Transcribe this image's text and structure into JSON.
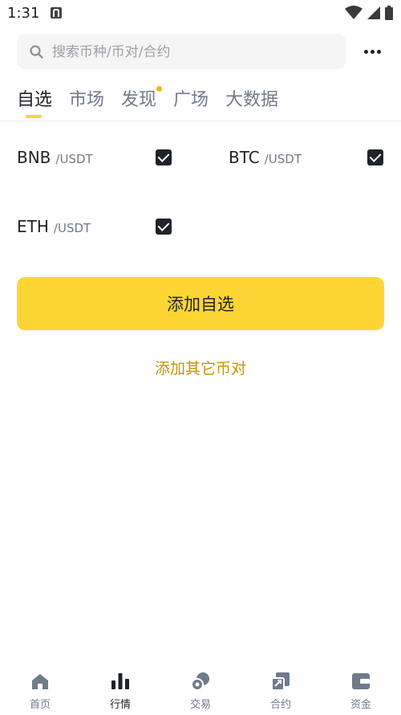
{
  "status_bar": {
    "time": "1:31"
  },
  "search": {
    "placeholder": "搜索币种/币对/合约"
  },
  "tabs": [
    {
      "label": "自选",
      "active": true
    },
    {
      "label": "市场",
      "active": false
    },
    {
      "label": "发现",
      "active": false,
      "badge_dot": true
    },
    {
      "label": "广场",
      "active": false
    },
    {
      "label": "大数据",
      "active": false
    }
  ],
  "pairs": [
    {
      "base": "BNB",
      "quote": "/USDT",
      "checked": true
    },
    {
      "base": "BTC",
      "quote": "/USDT",
      "checked": true
    },
    {
      "base": "ETH",
      "quote": "/USDT",
      "checked": true
    }
  ],
  "actions": {
    "add_watchlist": "添加自选",
    "add_other_pairs": "添加其它币对"
  },
  "bottom_nav": [
    {
      "label": "首页",
      "icon": "home-icon",
      "active": false
    },
    {
      "label": "行情",
      "icon": "markets-icon",
      "active": true
    },
    {
      "label": "交易",
      "icon": "trade-icon",
      "active": false
    },
    {
      "label": "合约",
      "icon": "futures-icon",
      "active": false
    },
    {
      "label": "资金",
      "icon": "wallet-icon",
      "active": false
    }
  ],
  "colors": {
    "accent": "#fcd535",
    "link": "#c99400",
    "text_primary": "#1e2329",
    "text_secondary": "#707a8a",
    "badge": "#f0b90b"
  }
}
